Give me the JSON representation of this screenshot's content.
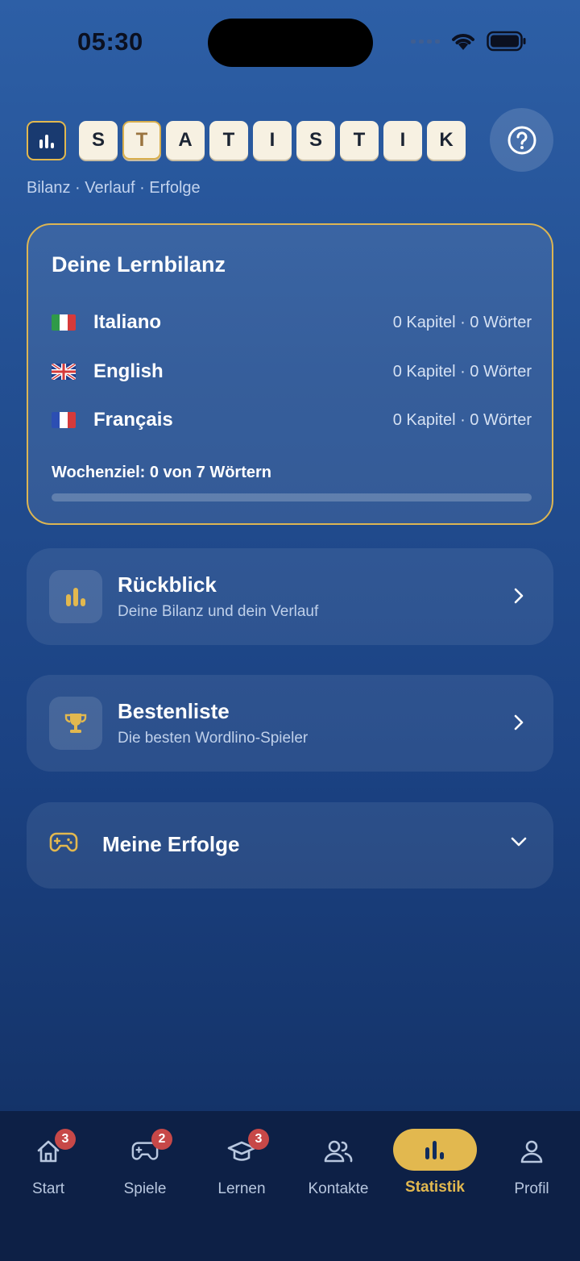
{
  "status_bar": {
    "time": "05:30"
  },
  "header": {
    "tiles": [
      "S",
      "T",
      "A",
      "T",
      "I",
      "S",
      "T",
      "I",
      "K"
    ],
    "subtitle": "Bilanz · Verlauf · Erfolge"
  },
  "summary": {
    "title": "Deine Lernbilanz",
    "languages": [
      {
        "name": "Italiano",
        "stats": "0 Kapitel · 0 Wörter",
        "flag": "italy-flag"
      },
      {
        "name": "English",
        "stats": "0 Kapitel · 0 Wörter",
        "flag": "uk-flag"
      },
      {
        "name": "Français",
        "stats": "0 Kapitel · 0 Wörter",
        "flag": "france-flag"
      }
    ],
    "weekly_goal": "Wochenziel: 0 von 7 Wörtern",
    "weekly_progress": 0
  },
  "cards": {
    "review": {
      "title": "Rückblick",
      "desc": "Deine Bilanz und dein Verlauf",
      "icon": "bar-chart-icon"
    },
    "leaderboard": {
      "title": "Bestenliste",
      "desc": "Die besten Wordlino-Spieler",
      "icon": "trophy-icon"
    },
    "achievements": {
      "title": "Meine Erfolge",
      "icon": "gamepad-icon"
    }
  },
  "tabbar": {
    "items": [
      {
        "label": "Start",
        "badge": "3",
        "icon": "home-icon"
      },
      {
        "label": "Spiele",
        "badge": "2",
        "icon": "gamepad-icon"
      },
      {
        "label": "Lernen",
        "badge": "3",
        "icon": "graduation-cap-icon"
      },
      {
        "label": "Kontakte",
        "icon": "contacts-icon"
      },
      {
        "label": "Statistik",
        "icon": "bar-chart-icon",
        "active": true
      },
      {
        "label": "Profil",
        "icon": "person-icon"
      }
    ]
  },
  "colors": {
    "accent": "#e2b84f",
    "badge": "#c74848",
    "tile": "#f7f1e2"
  }
}
